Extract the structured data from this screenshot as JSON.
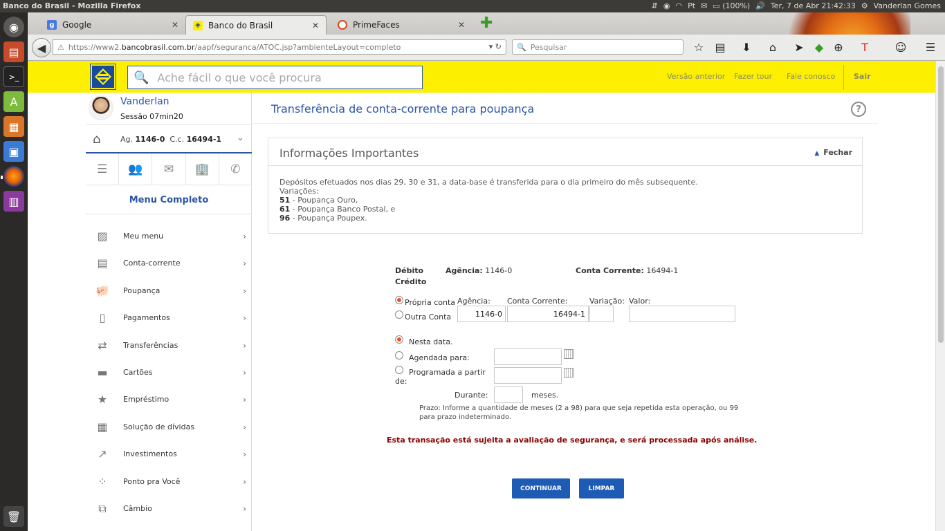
{
  "os": {
    "window_title": "Banco do Brasil - Mozilla Firefox",
    "battery": "(100%)",
    "clock": "Ter, 7 de Abr 21:42:33",
    "user": "Vanderlan Gomes"
  },
  "browser": {
    "tabs": [
      {
        "label": "Google"
      },
      {
        "label": "Banco do Brasil"
      },
      {
        "label": "PrimeFaces"
      }
    ],
    "url_prefix": "https://www2.",
    "url_host": "bancobrasil.com.br",
    "url_path": "/aapf/seguranca/ATOC.jsp?ambienteLayout=completo",
    "search_placeholder": "Pesquisar"
  },
  "header": {
    "search_placeholder": "Ache fácil o que você procura",
    "links": [
      "Versão anterior",
      "Fazer tour",
      "Fale conosco"
    ],
    "logout": "Sair"
  },
  "sidebar": {
    "user_name": "Vanderlan",
    "session": "Sessão 07min20",
    "agency_label": "Ag.",
    "agency": "1146-0",
    "account_label": "C.c.",
    "account": "16494-1",
    "menu_title": "Menu Completo",
    "items": [
      {
        "label": "Meu menu",
        "icon": "my-menu-icon"
      },
      {
        "label": "Conta-corrente",
        "icon": "statement-icon"
      },
      {
        "label": "Poupança",
        "icon": "piggy-bank-icon"
      },
      {
        "label": "Pagamentos",
        "icon": "barcode-icon"
      },
      {
        "label": "Transferências",
        "icon": "transfer-icon"
      },
      {
        "label": "Cartões",
        "icon": "card-icon"
      },
      {
        "label": "Empréstimo",
        "icon": "loan-icon"
      },
      {
        "label": "Solução de dívidas",
        "icon": "calculator-icon"
      },
      {
        "label": "Investimentos",
        "icon": "chart-icon"
      },
      {
        "label": "Ponto pra Você",
        "icon": "points-icon"
      },
      {
        "label": "Câmbio",
        "icon": "exchange-icon"
      }
    ]
  },
  "main": {
    "title": "Transferência de conta-corrente para poupança",
    "info": {
      "title": "Informações Importantes",
      "close_label": "Fechar",
      "line1": "Depósitos efetuados nos dias 29, 30 e 31, a data-base é transferida para o dia primeiro do mês subsequente.",
      "line2": "Variações:",
      "variations": [
        {
          "code": "51",
          "text": " - Poupança Ouro,"
        },
        {
          "code": "61",
          "text": " - Poupança Banco Postal, e"
        },
        {
          "code": "96",
          "text": " - Poupança Poupex."
        }
      ]
    },
    "form": {
      "debit_label": "Débito",
      "credit_label": "Crédito",
      "agency_label": "Agência:",
      "agency_value": "1146-0",
      "account_label": "Conta Corrente:",
      "account_value": "16494-1",
      "own_account": "Própria conta",
      "other_account": "Outra Conta",
      "col_agency": "Agência:",
      "col_account": "Conta Corrente:",
      "col_variation": "Variação:",
      "col_value": "Valor:",
      "credit_agency": "1146-0",
      "credit_account": "16494-1",
      "variation": "",
      "amount": "",
      "option_today": "Nesta data.",
      "option_scheduled": "Agendada para:",
      "option_programmed_1": "Programada a partir",
      "option_programmed_2": "de:",
      "duration_label": "Durante:",
      "months_label": "meses.",
      "deadline_text_1": "Prazo: Informe a quantidade de meses (2 a 98) para que seja repetida esta operação, ou 99",
      "deadline_text_2": "para prazo indeterminado.",
      "warning": "Esta transação está sujeita a avaliação de segurança, e será processada após análise.",
      "continue_button": "CONTINUAR",
      "clear_button": "LIMPAR"
    }
  },
  "colors": {
    "bb_yellow": "#fcf000",
    "bb_blue": "#2b56a6",
    "button_blue": "#1e5bb5",
    "warning_red": "#8b0000"
  }
}
